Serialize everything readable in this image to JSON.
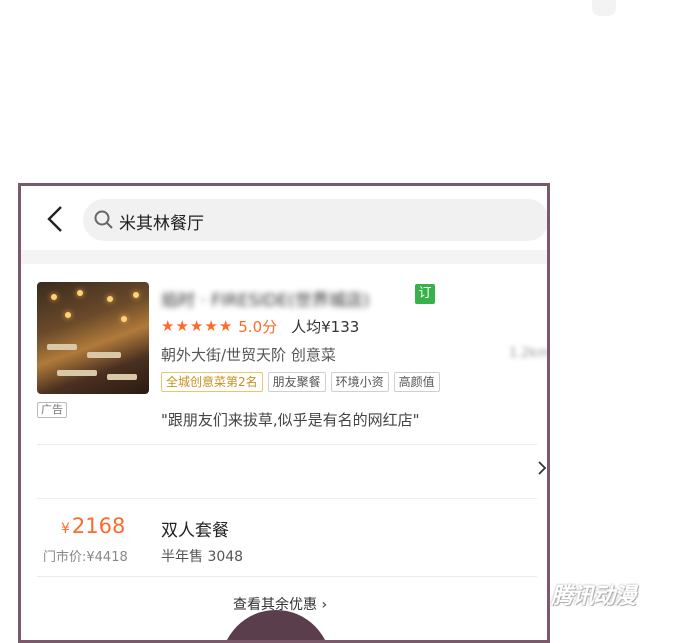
{
  "search": {
    "query": "米其林餐厅"
  },
  "listing": {
    "title": "焰时 · FIRESIDE(世界城店)",
    "reserve_badge": "订",
    "ad_label": "广告",
    "score": "5.0分",
    "avg_price": "人均¥133",
    "area_cuisine": "朝外大街/世贸天阶  创意菜",
    "distance": "1.2km",
    "tags": [
      "全城创意菜第2名",
      "朋友聚餐",
      "环境小资",
      "高颜值"
    ],
    "quote": "\"跟朋友们来拔草,似乎是有名的网红店\"",
    "rating_stars": 5
  },
  "deal": {
    "currency": "¥",
    "price": "2168",
    "original_price": "门市价:¥4418",
    "name": "双人套餐",
    "sales": "半年售 3048"
  },
  "more_link": "查看其余优惠 ›",
  "watermark": "腾讯动漫",
  "colors": {
    "accent": "#ff6a2a",
    "reserve_green": "#38b14a",
    "frame": "#7a5a6a"
  }
}
